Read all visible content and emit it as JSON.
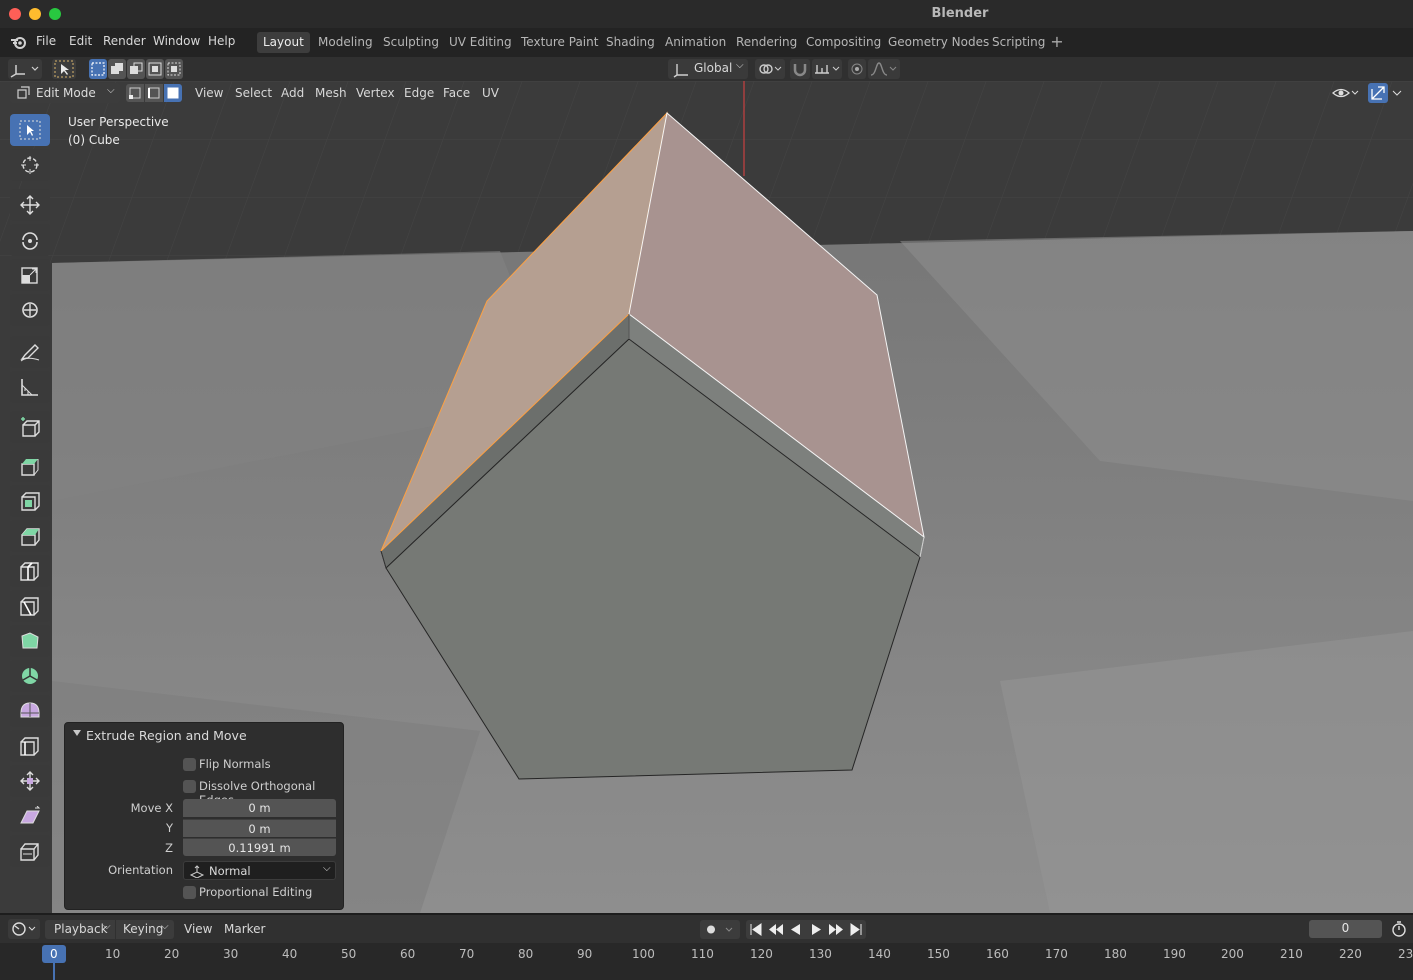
{
  "window": {
    "title": "Blender"
  },
  "menu": {
    "items": [
      "File",
      "Edit",
      "Render",
      "Window",
      "Help"
    ]
  },
  "workspaces": {
    "tabs": [
      "Layout",
      "Modeling",
      "Sculpting",
      "UV Editing",
      "Texture Paint",
      "Shading",
      "Animation",
      "Rendering",
      "Compositing",
      "Geometry Nodes",
      "Scripting"
    ],
    "active": "Layout"
  },
  "tool_header": {
    "transform_orientation": "Global"
  },
  "viewport_header": {
    "mode": "Edit Mode",
    "menus": [
      "View",
      "Select",
      "Add",
      "Mesh",
      "Vertex",
      "Edge",
      "Face",
      "UV"
    ]
  },
  "viewport_info": {
    "view": "User Perspective",
    "object": "(0) Cube"
  },
  "operator_panel": {
    "title": "Extrude Region and Move",
    "flip_normals": "Flip Normals",
    "flip_normals_checked": false,
    "dissolve_orthogonal": "Dissolve Orthogonal Edges",
    "dissolve_orthogonal_checked": false,
    "move_label": "Move X",
    "y_label": "Y",
    "z_label": "Z",
    "move_x": "0 m",
    "move_y": "0 m",
    "move_z": "0.11991 m",
    "orientation_label": "Orientation",
    "orientation_value": "Normal",
    "proportional_editing": "Proportional Editing",
    "proportional_editing_checked": false
  },
  "timeline": {
    "menus": [
      "Playback",
      "Keying",
      "View",
      "Marker"
    ],
    "current_frame": "0",
    "ruler": [
      "0",
      "10",
      "20",
      "30",
      "40",
      "50",
      "60",
      "70",
      "80",
      "90",
      "100",
      "110",
      "120",
      "130",
      "140",
      "150",
      "160",
      "170",
      "180",
      "190",
      "200",
      "210",
      "220",
      "23"
    ]
  },
  "colors": {
    "accent": "#4772b3",
    "selected_face": "#b59f91",
    "selected_edge": "#ffa040",
    "grid_bg": "#3a3a3a",
    "floor": "#8a8a8a"
  }
}
